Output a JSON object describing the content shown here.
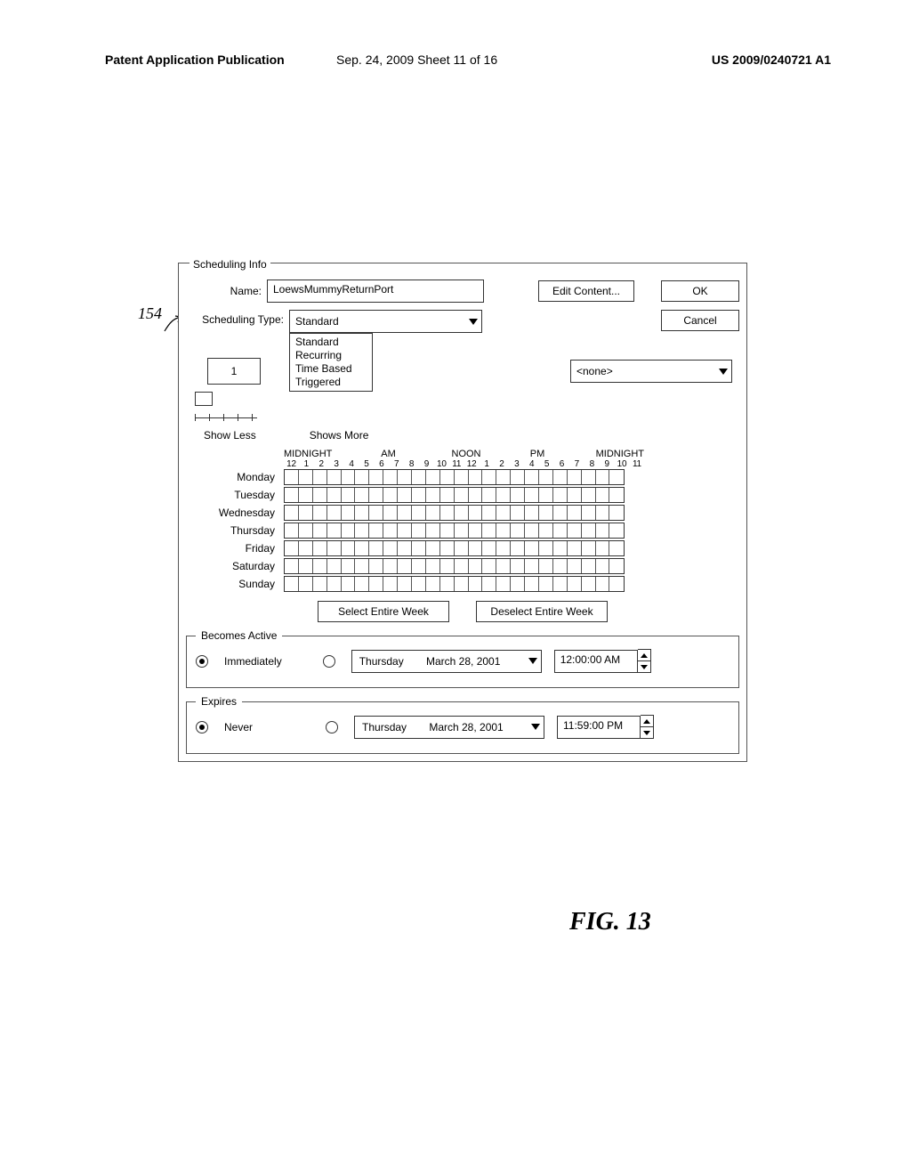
{
  "header": {
    "left": "Patent Application Publication",
    "mid": "Sep. 24, 2009  Sheet 11 of 16",
    "right": "US 2009/0240721 A1"
  },
  "callout": "154",
  "panel": {
    "title": "Scheduling Info",
    "name_label": "Name:",
    "name_value": "LoewsMummyReturnPort",
    "edit_content": "Edit Content...",
    "ok": "OK",
    "cancel": "Cancel",
    "sched_type_label": "Scheduling Type:",
    "sched_type_value": "Standard",
    "sched_type_options": [
      "Standard",
      "Recurring",
      "Time Based",
      "Triggered"
    ],
    "count_value": "1",
    "show_less": "Show Less",
    "shows_more": "Shows More",
    "none_value": "<none>",
    "time_sections": {
      "mid1": "MIDNIGHT",
      "am": "AM",
      "noon": "NOON",
      "pm": "PM",
      "mid2": "MIDNIGHT"
    },
    "hours": [
      "12",
      "1",
      "2",
      "3",
      "4",
      "5",
      "6",
      "7",
      "8",
      "9",
      "10",
      "11",
      "12",
      "1",
      "2",
      "3",
      "4",
      "5",
      "6",
      "7",
      "8",
      "9",
      "10",
      "11"
    ],
    "days": [
      "Monday",
      "Tuesday",
      "Wednesday",
      "Thursday",
      "Friday",
      "Saturday",
      "Sunday"
    ],
    "select_week": "Select Entire Week",
    "deselect_week": "Deselect Entire Week",
    "becomes_active": {
      "legend": "Becomes Active",
      "imm": "Immediately",
      "date_day": "Thursday",
      "date_full": "March 28, 2001",
      "time": "12:00:00 AM"
    },
    "expires": {
      "legend": "Expires",
      "never": "Never",
      "date_day": "Thursday",
      "date_full": "March 28, 2001",
      "time": "11:59:00 PM"
    }
  },
  "figure_label": "FIG. 13"
}
